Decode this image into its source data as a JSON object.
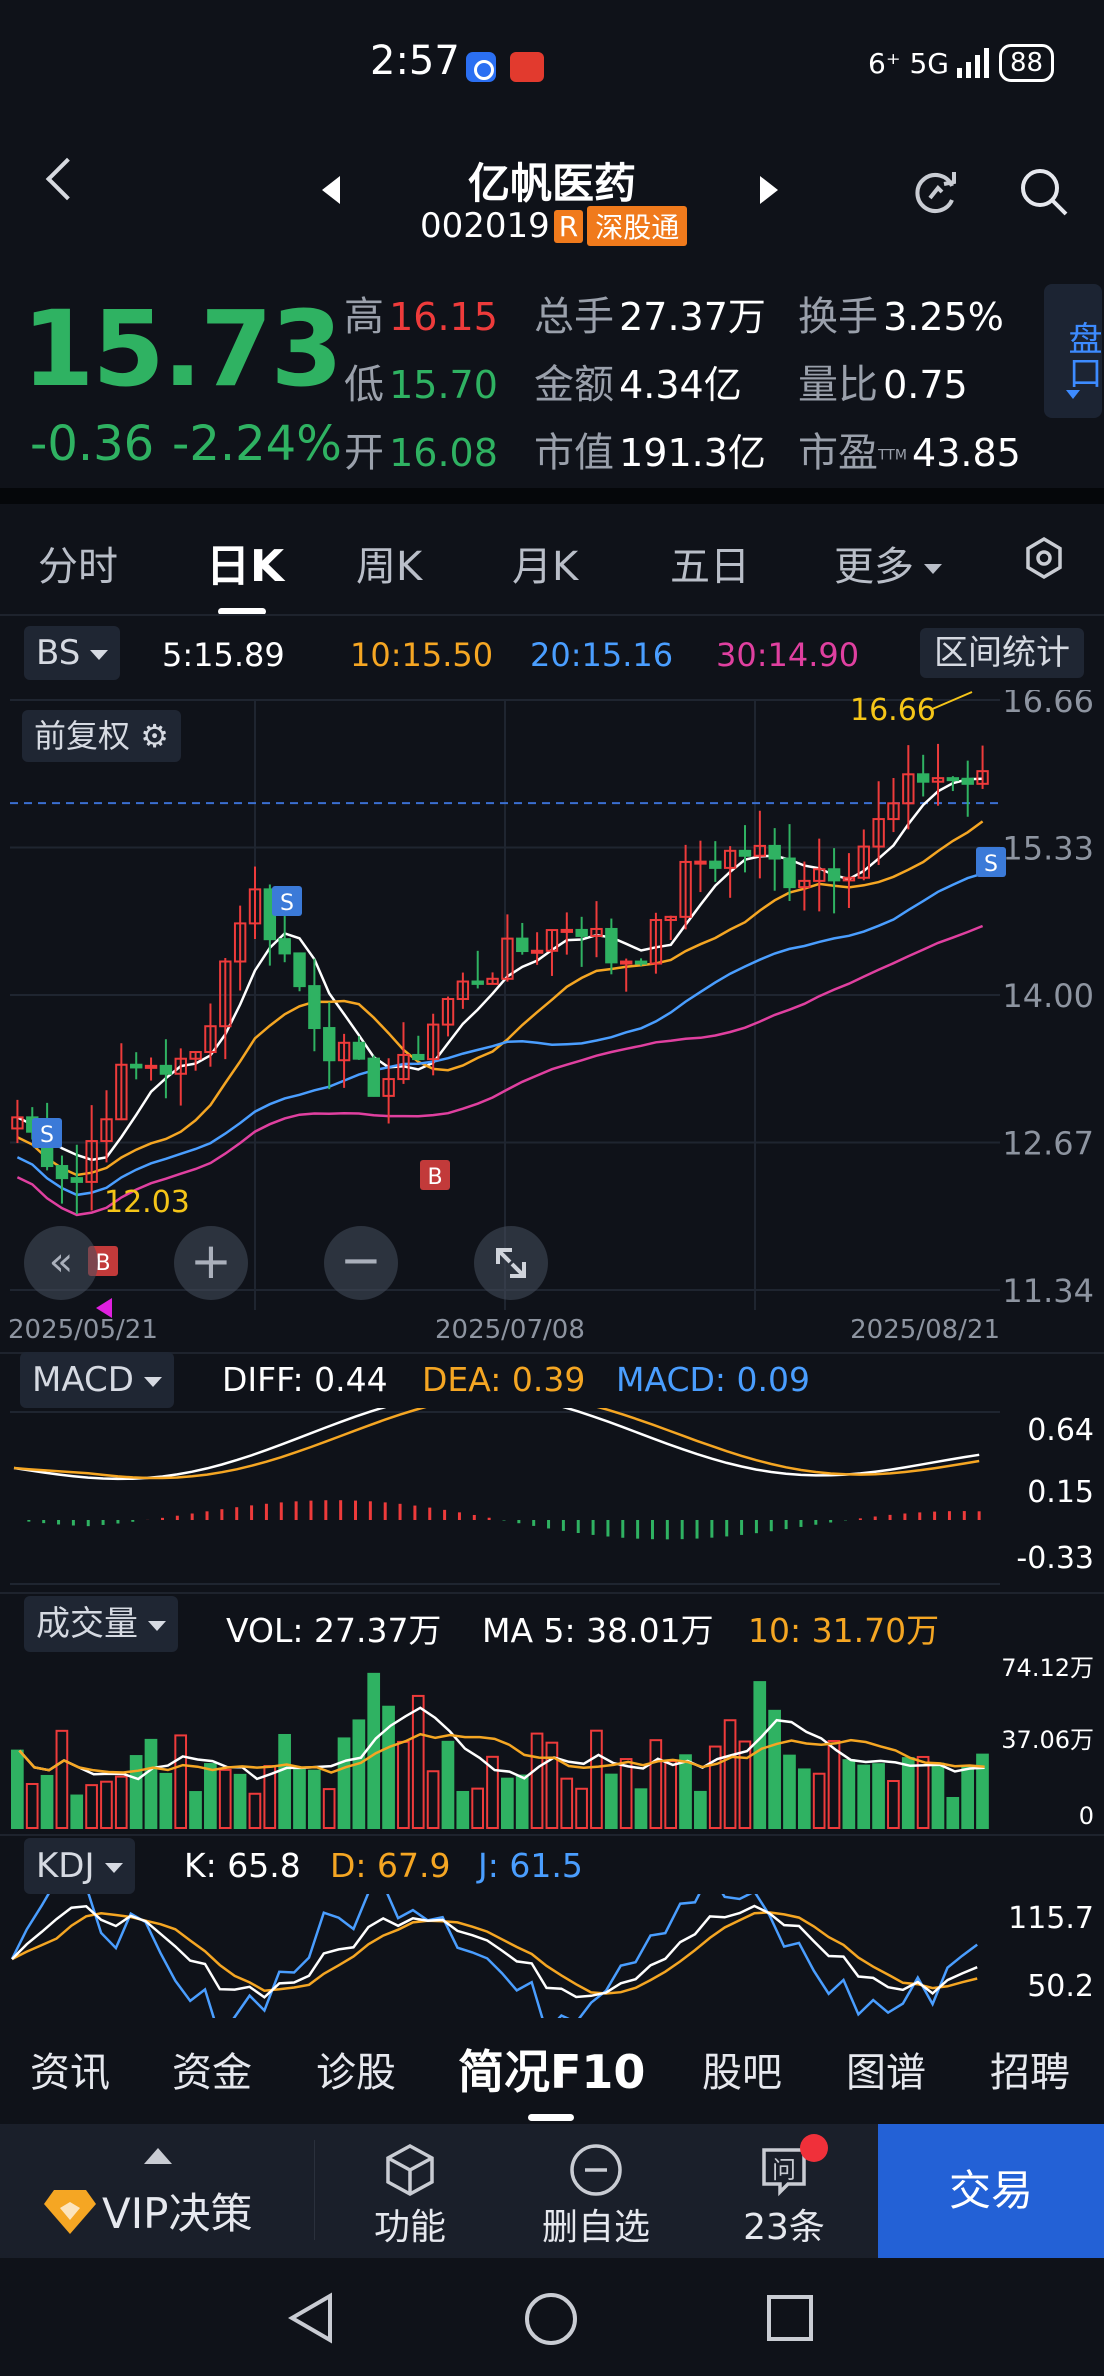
{
  "status_bar": {
    "time": "2:57",
    "signal": "6⁺ 5G",
    "battery": "88"
  },
  "header": {
    "name": "亿帆医药",
    "code": "002019",
    "badge_r": "R",
    "badge_market": "深股通"
  },
  "quote": {
    "price": "15.73",
    "change": "-0.36",
    "change_pct": "-2.24%",
    "high_label": "高",
    "high": "16.15",
    "low_label": "低",
    "low": "15.70",
    "open_label": "开",
    "open": "16.08",
    "volume_label": "总手",
    "volume": "27.37万",
    "amount_label": "金额",
    "amount": "4.34亿",
    "mktcap_label": "市值",
    "mktcap": "191.3亿",
    "turnover_label": "换手",
    "turnover": "3.25%",
    "vol_ratio_label": "量比",
    "vol_ratio": "0.75",
    "pe_label": "市盈",
    "pe_sup": "TTM",
    "pe": "43.85",
    "pankou": "盘口"
  },
  "period_tabs": [
    "分时",
    "日K",
    "周K",
    "月K",
    "五日",
    "更多"
  ],
  "ma_row": {
    "bs": "BS",
    "ma5": "5:15.89",
    "ma10": "10:15.50",
    "ma20": "20:15.16",
    "ma30": "30:14.90",
    "range_stats": "区间统计"
  },
  "kline": {
    "adjust_label": "前复权",
    "y_labels": [
      "16.66",
      "15.33",
      "14.00",
      "12.67",
      "11.34"
    ],
    "x_labels": [
      "2025/05/21",
      "2025/07/08",
      "2025/08/21"
    ],
    "max_label": "16.66",
    "min_label": "12.03",
    "markers": [
      "S",
      "S",
      "B",
      "B",
      "S"
    ]
  },
  "macd": {
    "selector": "MACD",
    "diff": "DIFF: 0.44",
    "dea": "DEA: 0.39",
    "macd": "MACD: 0.09",
    "y_labels": [
      "0.64",
      "0.15",
      "-0.33"
    ]
  },
  "volume": {
    "selector": "成交量",
    "vol": "VOL:  27.37万",
    "ma5": "MA 5:  38.01万",
    "ma10": "10:  31.70万",
    "y_labels": [
      "74.12万",
      "37.06万",
      "0"
    ]
  },
  "kdj": {
    "selector": "KDJ",
    "k": "K:  65.8",
    "d": "D:  67.9",
    "j": "J:  61.5",
    "y_labels": [
      "115.7",
      "50.2"
    ]
  },
  "bottom_tabs": [
    "资讯",
    "资金",
    "诊股",
    "简况F10",
    "股吧",
    "图谱",
    "招聘"
  ],
  "actions": {
    "vip": "VIP决策",
    "function": "功能",
    "remove_watch": "删自选",
    "questions": "23条",
    "trade": "交易"
  },
  "colors": {
    "up": "#ee3b3b",
    "down": "#2fb262",
    "ma5": "#ffffff",
    "ma10": "#f5a623",
    "ma20": "#4a9eff",
    "ma30": "#e040a0",
    "accent": "#2361d6"
  }
}
